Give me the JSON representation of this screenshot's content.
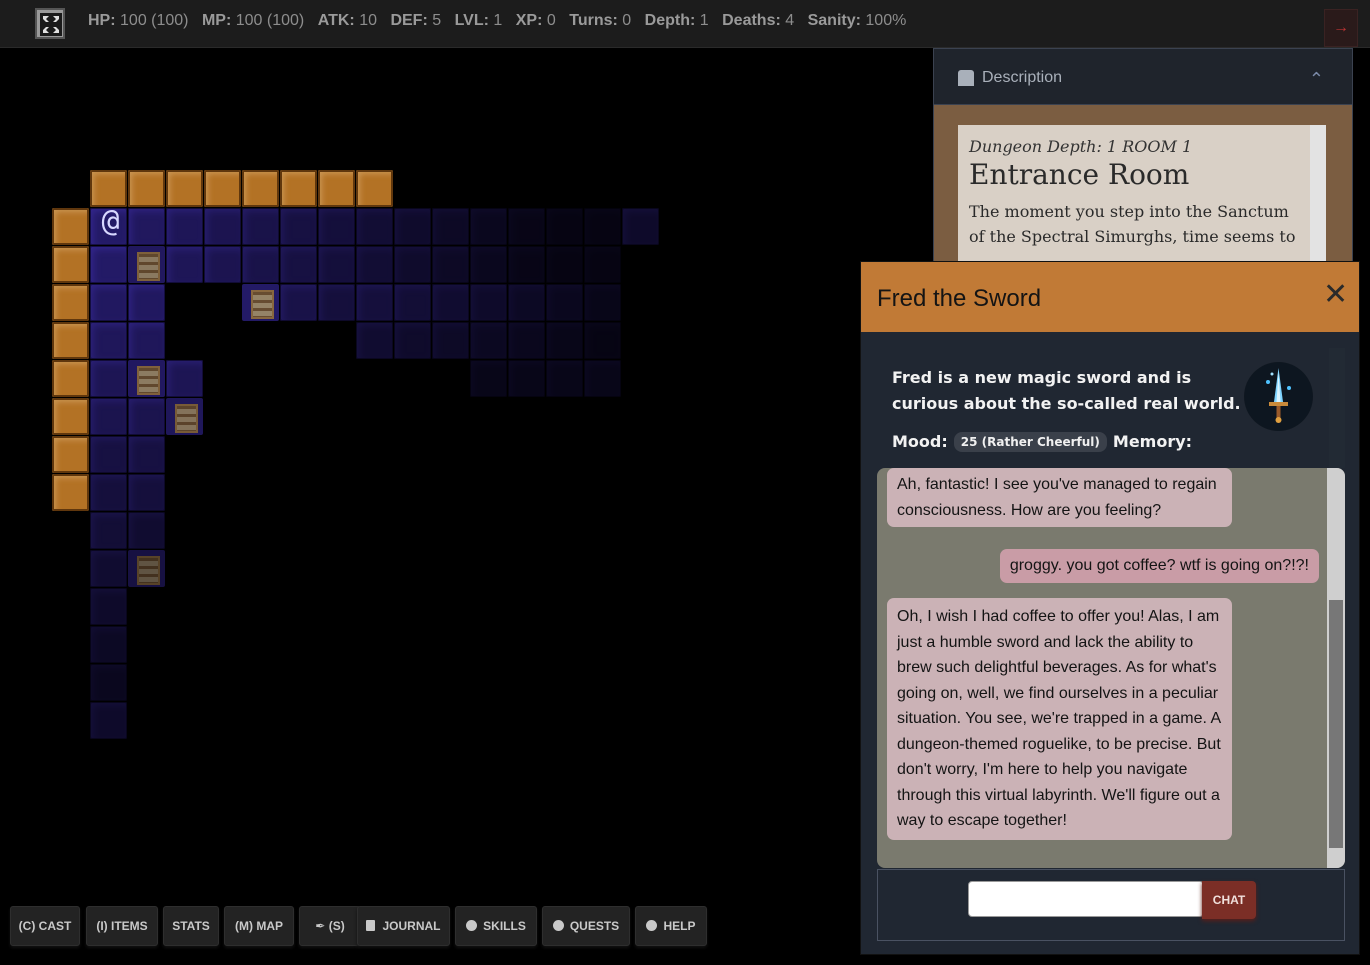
{
  "status_bar": {
    "stats": [
      {
        "label": "HP:",
        "value": "100 (100)"
      },
      {
        "label": "MP:",
        "value": "100 (100)"
      },
      {
        "label": "ATK:",
        "value": "10"
      },
      {
        "label": "DEF:",
        "value": "5"
      },
      {
        "label": "LVL:",
        "value": "1"
      },
      {
        "label": "XP:",
        "value": "0"
      },
      {
        "label": "Turns:",
        "value": "0"
      },
      {
        "label": "Depth:",
        "value": "1"
      },
      {
        "label": "Deaths:",
        "value": "4"
      },
      {
        "label": "Sanity:",
        "value": "100%"
      }
    ],
    "fullscreen_icon": "expand-icon",
    "collapse_icon": "arrow-right-icon"
  },
  "map": {
    "player_glyph": "@",
    "colors": {
      "floor": "#2a1f78",
      "wall": "#c77f2a",
      "background": "#000000"
    }
  },
  "description": {
    "header_label": "Description",
    "icon": "dungeon-gate-icon",
    "depth_line": "Dungeon Depth: 1 ROOM 1",
    "room_title": "Entrance Room",
    "text": "The moment you step into the Sanctum of the Spectral Simurghs, time seems to"
  },
  "chat_modal": {
    "title": "Fred the Sword",
    "close_icon": "close-icon",
    "npc_description": "Fred is a new magic sword and is curious about the so-called real world.",
    "mood_label": "Mood:",
    "mood_value": "25 (Rather Cheerful)",
    "memory_label": "Memory:",
    "messages": [
      {
        "from": "npc",
        "text": "Ah, fantastic! I see you've managed to regain consciousness. How are you feeling?"
      },
      {
        "from": "player",
        "text": "groggy. you got coffee? wtf is going on?!?!"
      },
      {
        "from": "npc",
        "text": "Oh, I wish I had coffee to offer you! Alas, I am just a humble sword and lack the ability to brew such delightful beverages. As for what's going on, well, we find ourselves in a peculiar situation. You see, we're trapped in a game. A dungeon-themed roguelike, to be precise. But don't worry, I'm here to help you navigate through this virtual labyrinth. We'll figure out a way to escape together!"
      }
    ],
    "input_value": "",
    "chat_button": "CHAT",
    "colors": {
      "header": "#c17a36",
      "npc_bubble": "#cbb2b6",
      "player_bubble": "#c99ca6",
      "chat_button": "#7b2e26"
    }
  },
  "actions": [
    {
      "label": "(C) CAST"
    },
    {
      "label": "(I) ITEMS"
    },
    {
      "label": "STATS"
    },
    {
      "label": "(M) MAP"
    },
    {
      "label": "(S)",
      "icon": "quill-icon"
    },
    {
      "label": "JOURNAL",
      "icon": "book-icon"
    },
    {
      "label": "SKILLS",
      "icon": "skills-icon"
    },
    {
      "label": "QUESTS",
      "icon": "quests-icon"
    },
    {
      "label": "HELP",
      "icon": "help-icon"
    }
  ]
}
